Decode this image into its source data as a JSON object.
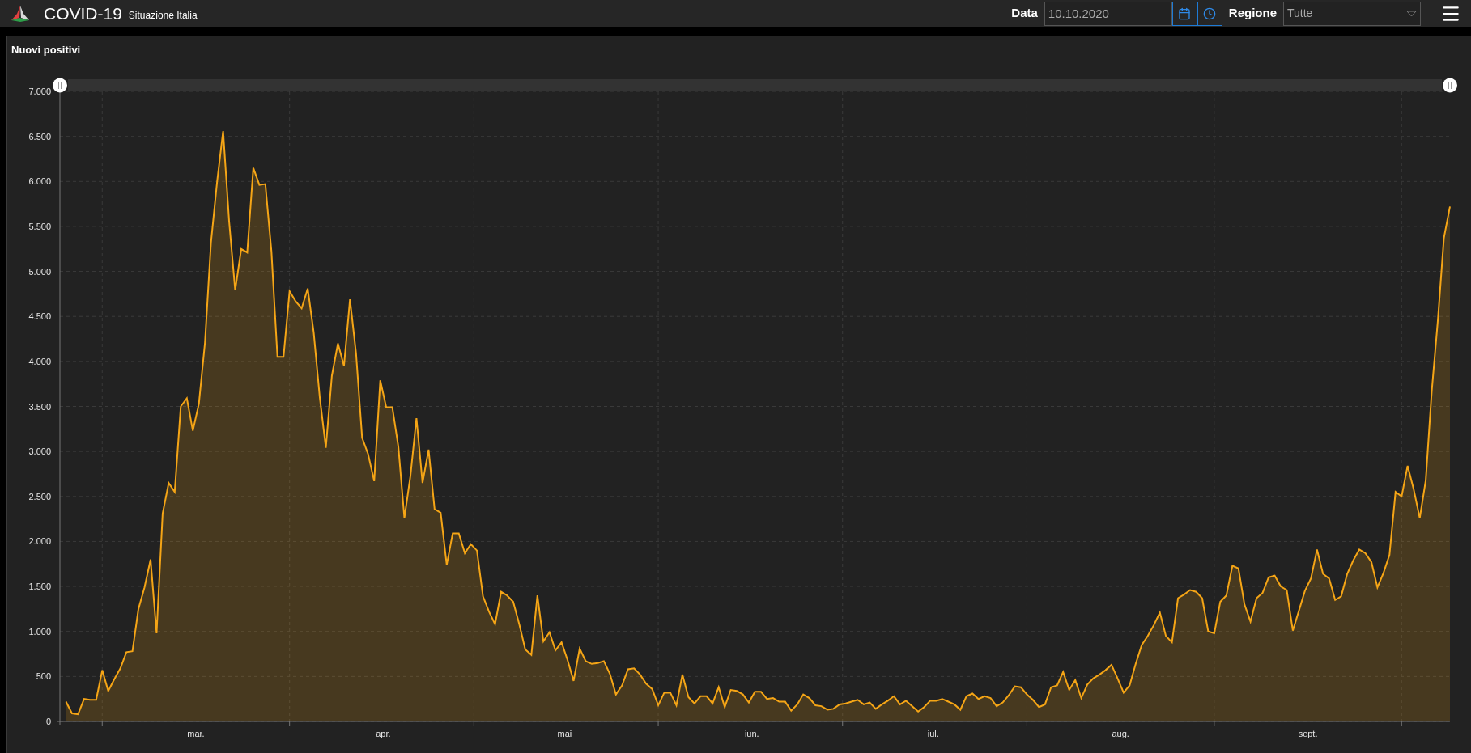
{
  "header": {
    "title": "COVID-19",
    "subtitle": "Situazione Italia",
    "date": {
      "label": "Data",
      "value": "10.10.2020"
    },
    "region": {
      "label": "Regione",
      "value": "Tutte"
    }
  },
  "panel": {
    "range_handles": [
      {
        "level": 0
      },
      {
        "level": 1
      }
    ],
    "chart_data": {
      "type": "area",
      "title": "Nuovi positivi",
      "grid": true,
      "ylim": [
        0,
        7000
      ],
      "categories": [
        null,
        null,
        null,
        null,
        null,
        null,
        null,
        null,
        null,
        null,
        null,
        null,
        null,
        null,
        null,
        null,
        null,
        null,
        null,
        null,
        null,
        "mar.",
        null,
        null,
        null,
        null,
        null,
        null,
        null,
        null,
        null,
        null,
        null,
        null,
        null,
        null,
        null,
        null,
        null,
        null,
        null,
        null,
        null,
        null,
        null,
        null,
        null,
        null,
        null,
        null,
        null,
        null,
        "apr.",
        null,
        null,
        null,
        null,
        null,
        null,
        null,
        null,
        null,
        null,
        null,
        null,
        null,
        null,
        null,
        null,
        null,
        null,
        null,
        null,
        null,
        null,
        null,
        null,
        null,
        null,
        null,
        null,
        null,
        "mai",
        null,
        null,
        null,
        null,
        null,
        null,
        null,
        null,
        null,
        null,
        null,
        null,
        null,
        null,
        null,
        null,
        null,
        null,
        null,
        null,
        null,
        null,
        null,
        null,
        null,
        null,
        null,
        null,
        null,
        null,
        "iun.",
        null,
        null,
        null,
        null,
        null,
        null,
        null,
        null,
        null,
        null,
        null,
        null,
        null,
        null,
        null,
        null,
        null,
        null,
        null,
        null,
        null,
        null,
        null,
        null,
        null,
        null,
        null,
        null,
        null,
        "iul.",
        null,
        null,
        null,
        null,
        null,
        null,
        null,
        null,
        null,
        null,
        null,
        null,
        null,
        null,
        null,
        null,
        null,
        null,
        null,
        null,
        null,
        null,
        null,
        null,
        null,
        null,
        null,
        null,
        null,
        null,
        "aug.",
        null,
        null,
        null,
        null,
        null,
        null,
        null,
        null,
        null,
        null,
        null,
        null,
        null,
        null,
        null,
        null,
        null,
        null,
        null,
        null,
        null,
        null,
        null,
        null,
        null,
        null,
        null,
        null,
        null,
        null,
        "sept.",
        null,
        null,
        null,
        null,
        null,
        null,
        null,
        null,
        null,
        null,
        null,
        null,
        null,
        null,
        null,
        null,
        null,
        null,
        null,
        null,
        null,
        null,
        null,
        null
      ],
      "yticks": [
        {
          "value": 0,
          "label": "0"
        },
        {
          "value": 500,
          "label": "500"
        },
        {
          "value": 1000,
          "label": "1.000"
        },
        {
          "value": 1500,
          "label": "1.500"
        },
        {
          "value": 2000,
          "label": "2.000"
        },
        {
          "value": 2500,
          "label": "2.500"
        },
        {
          "value": 3000,
          "label": "3.000"
        },
        {
          "value": 3500,
          "label": "3.500"
        },
        {
          "value": 4000,
          "label": "4.000"
        },
        {
          "value": 4500,
          "label": "4.500"
        },
        {
          "value": 5000,
          "label": "5.000"
        },
        {
          "value": 5500,
          "label": "5.500"
        },
        {
          "value": 6000,
          "label": "6.000"
        },
        {
          "value": 6500,
          "label": "6.500"
        },
        {
          "value": 7000,
          "label": "7.000"
        }
      ],
      "series": [
        {
          "color": "#f5a516",
          "values": [
            220,
            90,
            80,
            250,
            240,
            240,
            570,
            340,
            470,
            590,
            770,
            780,
            1250,
            1490,
            1800,
            980,
            2310,
            2650,
            2550,
            3500,
            3590,
            3230,
            3530,
            4210,
            5320,
            5990,
            6560,
            5560,
            4790,
            5250,
            5210,
            6150,
            5960,
            5970,
            5220,
            4050,
            4050,
            4780,
            4670,
            4590,
            4810,
            4320,
            3600,
            3040,
            3840,
            4200,
            3950,
            4690,
            4090,
            3150,
            2970,
            2670,
            3790,
            3490,
            3490,
            3050,
            2260,
            2730,
            3370,
            2650,
            3020,
            2360,
            2320,
            1740,
            2090,
            2090,
            1870,
            1970,
            1900,
            1390,
            1220,
            1080,
            1440,
            1400,
            1330,
            1080,
            800,
            740,
            1400,
            890,
            990,
            790,
            880,
            680,
            450,
            810,
            670,
            640,
            650,
            670,
            530,
            300,
            400,
            580,
            590,
            520,
            420,
            360,
            180,
            320,
            320,
            180,
            520,
            270,
            200,
            280,
            280,
            200,
            380,
            160,
            350,
            340,
            300,
            210,
            330,
            330,
            250,
            260,
            220,
            220,
            120,
            190,
            300,
            260,
            180,
            170,
            130,
            140,
            190,
            200,
            220,
            240,
            190,
            210,
            140,
            190,
            230,
            280,
            190,
            230,
            170,
            110,
            160,
            230,
            230,
            250,
            220,
            190,
            130,
            280,
            310,
            250,
            280,
            260,
            170,
            210,
            290,
            390,
            380,
            300,
            240,
            160,
            190,
            380,
            400,
            550,
            350,
            460,
            260,
            410,
            480,
            520,
            570,
            630,
            480,
            320,
            400,
            640,
            850,
            950,
            1070,
            1210,
            950,
            880,
            1370,
            1410,
            1460,
            1440,
            1370,
            1000,
            980,
            1330,
            1400,
            1730,
            1700,
            1300,
            1110,
            1370,
            1430,
            1600,
            1620,
            1500,
            1460,
            1010,
            1230,
            1450,
            1590,
            1910,
            1640,
            1590,
            1350,
            1390,
            1640,
            1790,
            1910,
            1870,
            1770,
            1490,
            1650,
            1850,
            2550,
            2500,
            2840,
            2580,
            2260,
            2680,
            3680,
            4460,
            5370,
            5720
          ]
        }
      ]
    }
  }
}
